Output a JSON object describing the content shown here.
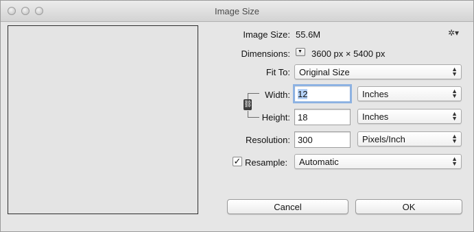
{
  "window": {
    "title": "Image Size"
  },
  "info": {
    "image_size_label": "Image Size:",
    "image_size_value": "55.6M",
    "dimensions_label": "Dimensions:",
    "dimensions_value": "3600 px  ×  5400 px"
  },
  "fit_to": {
    "label": "Fit To:",
    "value": "Original Size"
  },
  "width": {
    "label": "Width:",
    "value": "12",
    "unit": "Inches"
  },
  "height": {
    "label": "Height:",
    "value": "18",
    "unit": "Inches"
  },
  "resolution": {
    "label": "Resolution:",
    "value": "300",
    "unit": "Pixels/Inch"
  },
  "resample": {
    "label": "Resample:",
    "checked": true,
    "value": "Automatic"
  },
  "buttons": {
    "cancel": "Cancel",
    "ok": "OK"
  },
  "icons": {
    "gear": "gear-icon",
    "link": "chain-link-icon"
  }
}
